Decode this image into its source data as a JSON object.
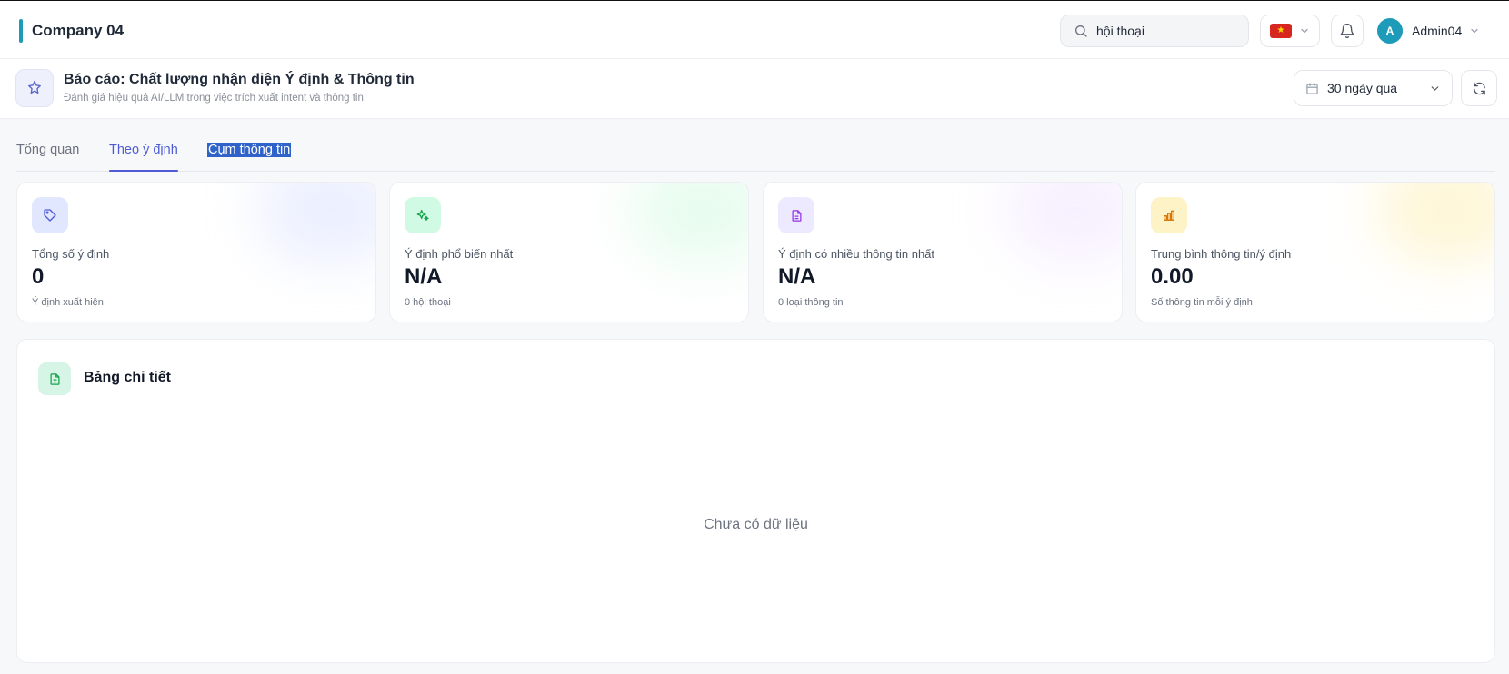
{
  "topbar": {
    "company": "Company 04",
    "search": {
      "value": "hội thoại",
      "placeholder": ""
    },
    "language_flag": "vn-flag",
    "user": {
      "avatar_initial": "A",
      "name": "Admin04"
    }
  },
  "report": {
    "title": "Báo cáo: Chất lượng nhận diện Ý định & Thông tin",
    "subtitle": "Đánh giá hiệu quả AI/LLM trong việc trích xuất intent và thông tin.",
    "date_range": "30 ngày qua"
  },
  "tabs": [
    {
      "label": "Tổng quan",
      "state": "inactive"
    },
    {
      "label": "Theo ý định",
      "state": "active"
    },
    {
      "label": "Cụm thông tin",
      "state": "text-selected"
    }
  ],
  "stats": [
    {
      "label": "Tổng số ý định",
      "value": "0",
      "sub": "Ý định xuất hiện",
      "icon": "tag-icon",
      "color": "#4f5bd5"
    },
    {
      "label": "Ý định phổ biến nhất",
      "value": "N/A",
      "sub": "0 hội thoại",
      "icon": "sparkles-icon",
      "color": "#16a34a"
    },
    {
      "label": "Ý định có nhiều thông tin nhất",
      "value": "N/A",
      "sub": "0 loại thông tin",
      "icon": "document-icon",
      "color": "#9333ea"
    },
    {
      "label": "Trung bình thông tin/ý định",
      "value": "0.00",
      "sub": "Số thông tin mỗi ý định",
      "icon": "bar-chart-icon",
      "color": "#d97706"
    }
  ],
  "detail": {
    "title": "Bảng chi tiết",
    "empty_message": "Chưa có dữ liệu"
  }
}
